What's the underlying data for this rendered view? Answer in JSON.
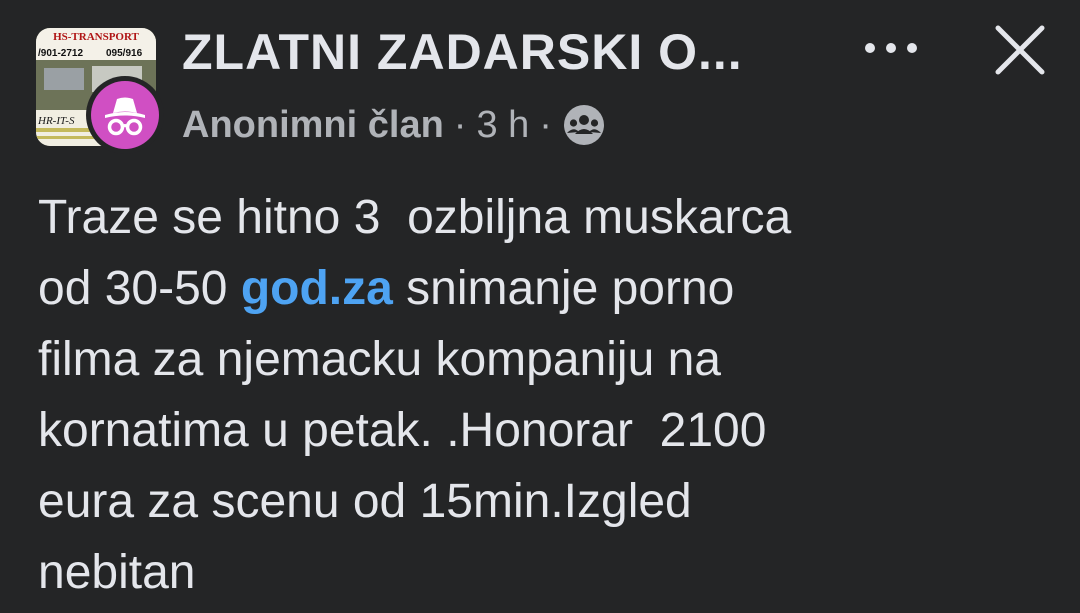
{
  "group": {
    "title": "ZLATNI ZADARSKI O...",
    "avatar_icon": "group-cover-thumbnail",
    "avatar_text_top": "HS-TRANSPORT",
    "avatar_text_phone1": "/901-2712",
    "avatar_text_phone2": "095/916",
    "avatar_text_mid": "HR-IT-S"
  },
  "post_meta": {
    "author": "Anonimni član",
    "separator": "·",
    "time": "3 h",
    "audience_icon": "group-members-icon"
  },
  "actions": {
    "more_icon": "more-options-icon",
    "close_icon": "close-icon"
  },
  "post": {
    "line1": "Traze se hitno 3  ozbiljna muskarca",
    "line2_before": "od 30-50 ",
    "line2_link": "god.za",
    "line2_after": " snimanje porno",
    "line3": "filma za njemacku kompaniju na",
    "line4": "kornatima u petak. .Honorar  2100",
    "line5": "eura za scenu od 15min.Izgled",
    "line6": "nebitan"
  },
  "colors": {
    "background": "#242526",
    "text": "#e4e6eb",
    "muted": "#b0b3b8",
    "link": "#4ea3f2",
    "anonymous_avatar": "#d04fc3"
  }
}
